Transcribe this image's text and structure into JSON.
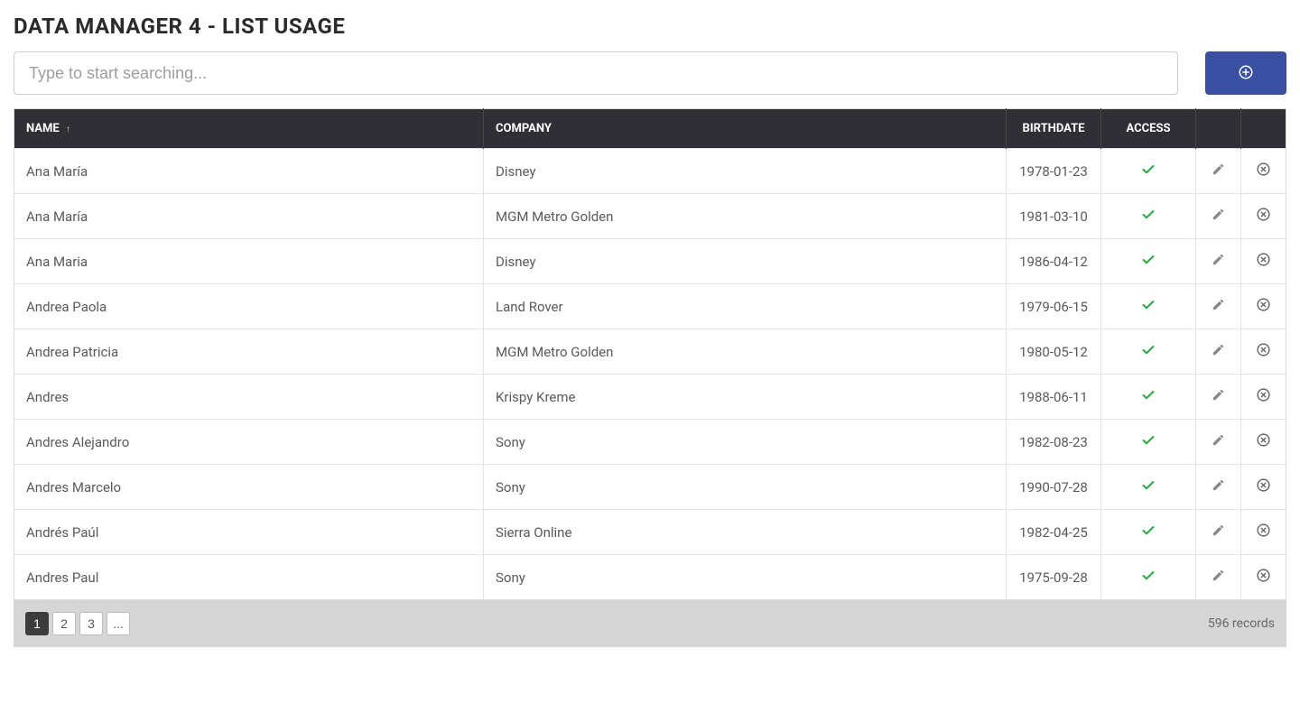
{
  "title": "DATA MANAGER 4 - LIST USAGE",
  "search": {
    "placeholder": "Type to start searching..."
  },
  "columns": {
    "name": "Name",
    "company": "Company",
    "birthdate": "Birthdate",
    "access": "Access"
  },
  "rows": [
    {
      "name": "Ana María",
      "company": "Disney",
      "birthdate": "1978-01-23",
      "access": true
    },
    {
      "name": "Ana María",
      "company": "MGM Metro Golden",
      "birthdate": "1981-03-10",
      "access": true
    },
    {
      "name": "Ana Maria",
      "company": "Disney",
      "birthdate": "1986-04-12",
      "access": true
    },
    {
      "name": "Andrea Paola",
      "company": "Land Rover",
      "birthdate": "1979-06-15",
      "access": true
    },
    {
      "name": "Andrea Patricia",
      "company": "MGM Metro Golden",
      "birthdate": "1980-05-12",
      "access": true
    },
    {
      "name": "Andres",
      "company": "Krispy Kreme",
      "birthdate": "1988-06-11",
      "access": true
    },
    {
      "name": "Andres Alejandro",
      "company": "Sony",
      "birthdate": "1982-08-23",
      "access": true
    },
    {
      "name": "Andres Marcelo",
      "company": "Sony",
      "birthdate": "1990-07-28",
      "access": true
    },
    {
      "name": "Andrés Paúl",
      "company": "Sierra Online",
      "birthdate": "1982-04-25",
      "access": true
    },
    {
      "name": "Andres Paul",
      "company": "Sony",
      "birthdate": "1975-09-28",
      "access": true
    }
  ],
  "pagination": {
    "pages": [
      "1",
      "2",
      "3",
      "..."
    ],
    "active": "1",
    "record_count": "596 records"
  }
}
